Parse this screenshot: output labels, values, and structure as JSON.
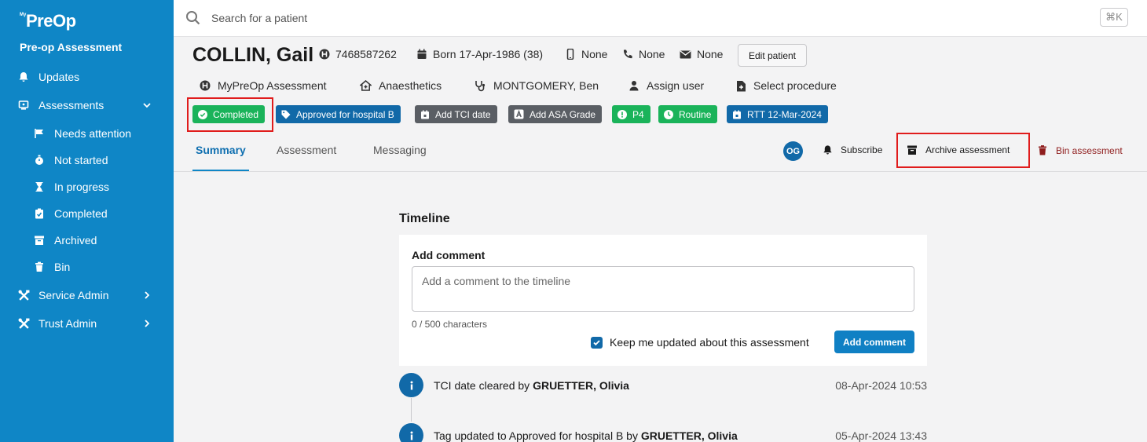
{
  "sidebar": {
    "logo_prefix": "My",
    "logo": "PreOp",
    "subtitle": "Pre-op Assessment",
    "items": [
      {
        "label": "Updates",
        "icon": "bell-icon"
      },
      {
        "label": "Assessments",
        "icon": "clipboard-icon"
      },
      {
        "label": "Needs attention",
        "icon": "flag-icon"
      },
      {
        "label": "Not started",
        "icon": "stopwatch-icon"
      },
      {
        "label": "In progress",
        "icon": "hourglass-icon"
      },
      {
        "label": "Completed",
        "icon": "clipboard-check-icon"
      },
      {
        "label": "Archived",
        "icon": "archive-icon"
      },
      {
        "label": "Bin",
        "icon": "trash-icon"
      },
      {
        "label": "Service Admin",
        "icon": "tools-icon"
      },
      {
        "label": "Trust Admin",
        "icon": "tools-icon"
      }
    ]
  },
  "search": {
    "placeholder": "Search for a patient",
    "shortcut": "⌘K"
  },
  "patient": {
    "name": "COLLIN, Gail",
    "hospital_number": "7468587262",
    "born": "Born 17-Apr-1986 (38)",
    "mobile": "None",
    "phone": "None",
    "email": "None",
    "edit_label": "Edit patient",
    "pathway": "MyPreOp Assessment",
    "specialty": "Anaesthetics",
    "consultant": "MONTGOMERY, Ben",
    "assign": "Assign user",
    "procedure": "Select procedure"
  },
  "tags": {
    "completed": "Completed",
    "approved": "Approved for hospital B",
    "tci": "Add TCI date",
    "asa": "Add ASA Grade",
    "priority": "P4",
    "routine": "Routine",
    "rtt": "RTT 12-Mar-2024"
  },
  "tabs": {
    "summary": "Summary",
    "assessment": "Assessment",
    "messaging": "Messaging"
  },
  "actions": {
    "avatar": "OG",
    "subscribe": "Subscribe",
    "archive": "Archive assessment",
    "bin": "Bin assessment"
  },
  "timeline": {
    "title": "Timeline",
    "add_label": "Add comment",
    "placeholder": "Add a comment to the timeline",
    "char_count": "0 / 500 characters",
    "keep_updated": "Keep me updated about this assessment",
    "add_button": "Add comment",
    "events": [
      {
        "text": "TCI date cleared by ",
        "user": "GRUETTER, Olivia",
        "date": "08-Apr-2024 10:53"
      },
      {
        "text": "Tag updated to Approved for hospital B by ",
        "user": "GRUETTER, Olivia",
        "date": "05-Apr-2024 13:43"
      }
    ]
  },
  "colors": {
    "sidebar": "#0f86c6",
    "primary": "#1169a8",
    "success": "#1ab35a",
    "highlight": "#e01c1c",
    "danger": "#8f1d1d"
  }
}
